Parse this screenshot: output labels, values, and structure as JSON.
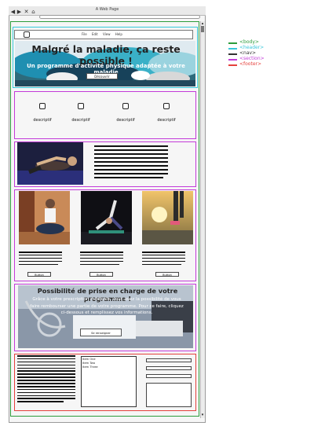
{
  "window": {
    "title": "A Web Page",
    "controls": [
      "◀",
      "▶",
      "✕",
      "⌂"
    ]
  },
  "nav": {
    "links": [
      "File",
      "Edit",
      "View",
      "Help"
    ]
  },
  "hero": {
    "title": "Malgré la maladie, ça reste possible !",
    "subtitle": "Un programme d'activité physique adaptée à votre maladie",
    "button": "Découvrir"
  },
  "features": {
    "items": [
      "descriptif",
      "descriptif",
      "descriptif",
      "descriptif"
    ]
  },
  "cards": {
    "button_label": "Button"
  },
  "promo": {
    "title": "Possibilité de prise en charge de votre programme !",
    "text": "Grâce à votre prescription médicale, vous avez la possibilité de vous faire rembourser une partie de votre programme. Pour ce faire, cliquez ci-dessous et remplissez vos informations.",
    "button": "Se renseigner"
  },
  "footer": {
    "list_items": [
      "Item One",
      "Item Two",
      "Item Three"
    ]
  },
  "legend": {
    "items": [
      {
        "label": "<body>",
        "color": "#2c9c3b"
      },
      {
        "label": "<header>",
        "color": "#37c7d9"
      },
      {
        "label": "<nav>",
        "color": "#333333"
      },
      {
        "label": "<section>",
        "color": "#c33bd9"
      },
      {
        "label": "<footer>",
        "color": "#e5413d"
      }
    ]
  }
}
